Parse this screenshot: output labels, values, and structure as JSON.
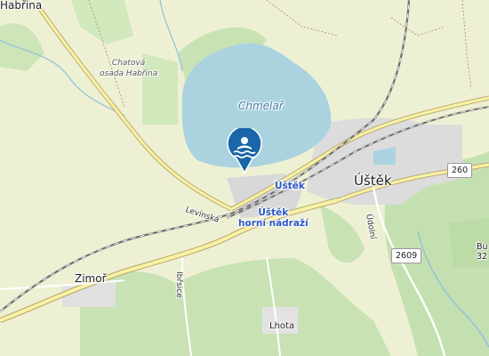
{
  "map": {
    "places": {
      "habrina": "Habřina",
      "chatova_osada_line1": "Chatová",
      "chatova_osada_line2": "osada Habřina",
      "chmelar": "Chmelař",
      "ustek": "Úštěk",
      "zimor": "Zimoř",
      "lhota": "Lhota",
      "bud": "Bu",
      "bud_elev": "32"
    },
    "stations": {
      "ustek": "Úštěk",
      "horni_line1": "Úštěk",
      "horni_line2": "horní nádraží"
    },
    "streets": {
      "levinska": "Levínská",
      "udolni": "Údolní",
      "ibrsice": "Ibřsice"
    },
    "road_numbers": {
      "r260": "260",
      "r2609": "2609"
    },
    "marker": {
      "icon": "swimming-icon",
      "color": "#1a66a8"
    }
  }
}
